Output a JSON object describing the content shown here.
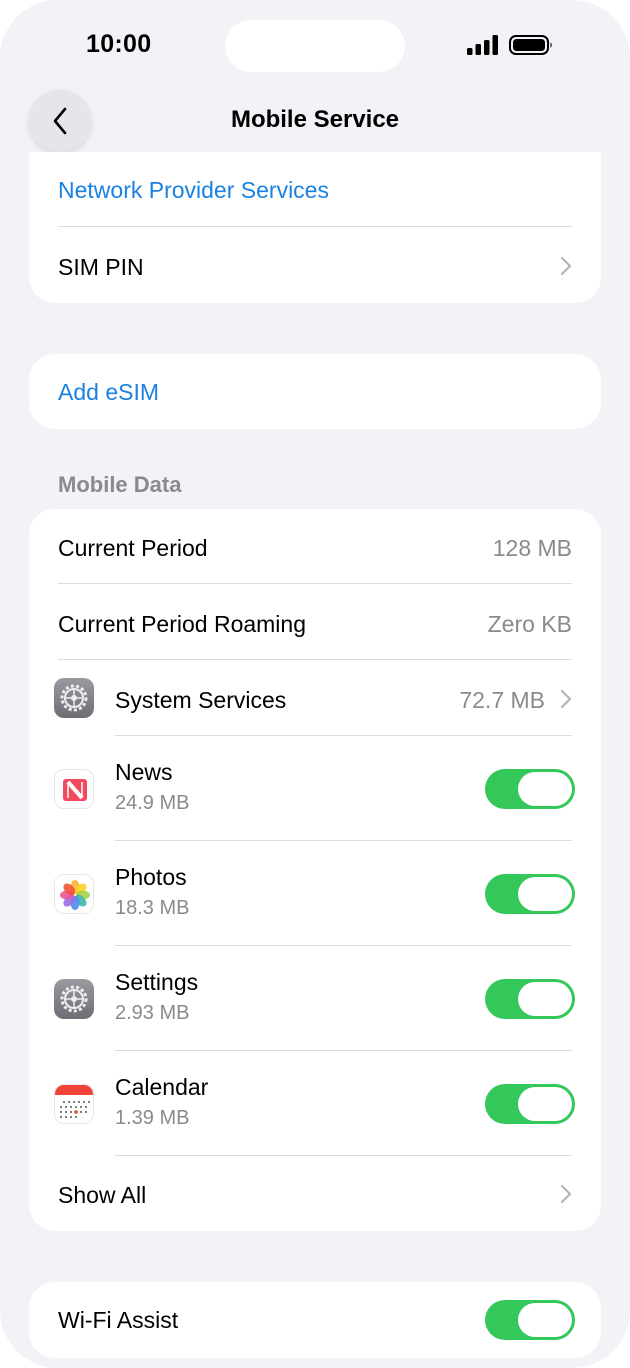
{
  "status_bar": {
    "time": "10:00"
  },
  "nav": {
    "title": "Mobile Service"
  },
  "group_top": {
    "network_provider_services": "Network Provider Services",
    "sim_pin": "SIM PIN"
  },
  "add_esim": "Add eSIM",
  "mobile_data": {
    "header": "Mobile Data",
    "current_period": {
      "label": "Current Period",
      "value": "128 MB"
    },
    "current_period_roaming": {
      "label": "Current Period Roaming",
      "value": "Zero KB"
    },
    "system_services": {
      "label": "System Services",
      "value": "72.7 MB",
      "icon": "gear-icon"
    },
    "apps": [
      {
        "name": "News",
        "size": "24.9 MB",
        "icon": "news-icon",
        "enabled": true
      },
      {
        "name": "Photos",
        "size": "18.3 MB",
        "icon": "photos-icon",
        "enabled": true
      },
      {
        "name": "Settings",
        "size": "2.93 MB",
        "icon": "gear-icon",
        "enabled": true
      },
      {
        "name": "Calendar",
        "size": "1.39 MB",
        "icon": "calendar-icon",
        "enabled": true
      }
    ],
    "show_all": "Show All"
  },
  "wifi_assist": {
    "label": "Wi-Fi Assist",
    "enabled": true
  },
  "colors": {
    "accent_blue": "#1a82e2",
    "toggle_on": "#34c759",
    "background": "#f2f2f7",
    "secondary_text": "#8a8a8e"
  }
}
